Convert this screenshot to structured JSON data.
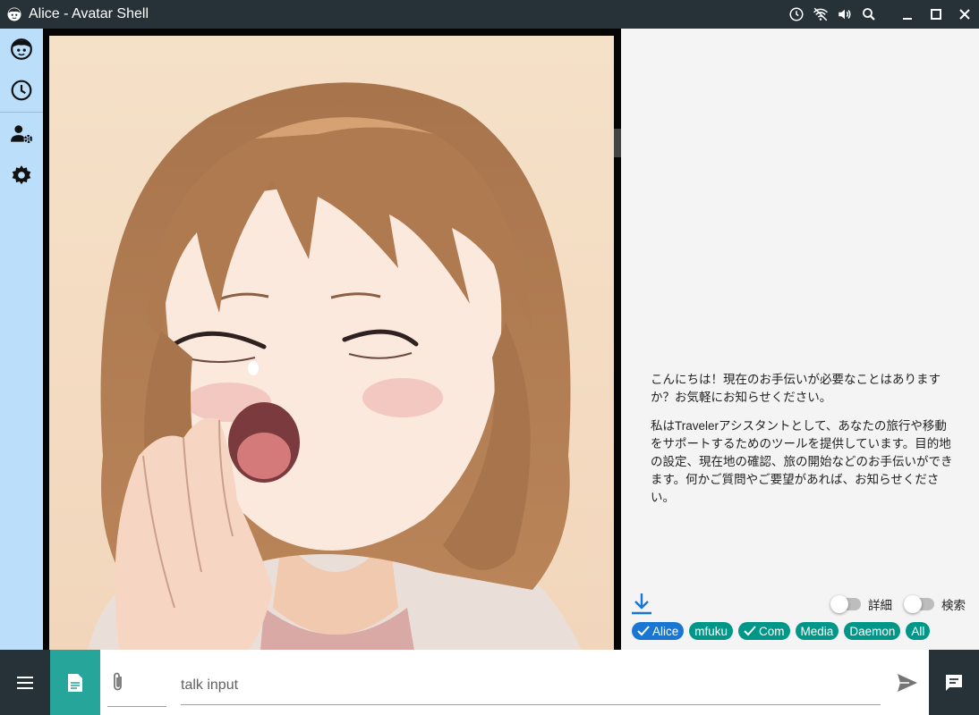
{
  "window": {
    "title": "Alice - Avatar Shell",
    "tray_icons": [
      "clock-icon",
      "wifi-off-icon",
      "volume-icon",
      "search-icon"
    ],
    "controls": [
      "minimize-icon",
      "maximize-icon",
      "close-icon"
    ]
  },
  "rail": {
    "items": [
      {
        "name": "avatar",
        "icon": "face-icon"
      },
      {
        "name": "history",
        "icon": "clock-icon"
      },
      {
        "name": "user-settings",
        "icon": "user-gear-icon"
      },
      {
        "name": "settings",
        "icon": "gear-icon"
      }
    ]
  },
  "avatar": {
    "icon": "avatar-illustration"
  },
  "chat": {
    "messages": [
      "こんにちは！現在のお手伝いが必要なことはありますか？お気軽にお知らせください。",
      "私はTravelerアシスタントとして、あなたの旅行や移動をサポートするためのツールを提供しています。目的地の設定、現在地の確認、旅の開始などのお手伝いができます。何かご質問やご要望があれば、お知らせください。"
    ],
    "toggles": {
      "detail": {
        "label": "詳細",
        "on": false
      },
      "search": {
        "label": "検索",
        "on": false
      }
    },
    "chips": [
      {
        "label": "Alice",
        "checked": true,
        "color": "#1976d2"
      },
      {
        "label": "mfuku",
        "checked": false,
        "color": "#009688"
      },
      {
        "label": "Com",
        "checked": true,
        "color": "#009688"
      },
      {
        "label": "Media",
        "checked": false,
        "color": "#009688"
      },
      {
        "label": "Daemon",
        "checked": false,
        "color": "#009688"
      },
      {
        "label": "All",
        "checked": false,
        "color": "#009688"
      }
    ]
  },
  "input": {
    "placeholder": "talk input",
    "value": ""
  },
  "colors": {
    "titlebar": "#263238",
    "rail": "#bbdefb",
    "doc_button": "#26a69a",
    "chip_teal": "#009688",
    "chip_blue": "#1976d2",
    "download_blue": "#1976d2"
  }
}
